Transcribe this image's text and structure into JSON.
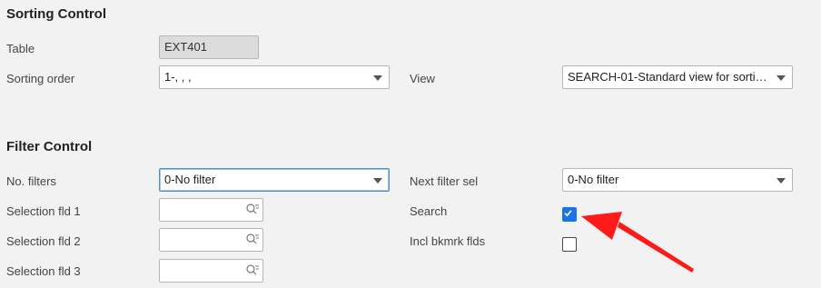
{
  "sorting": {
    "title": "Sorting Control",
    "table_label": "Table",
    "table_value": "EXT401",
    "order_label": "Sorting order",
    "order_value": "1-, , ,",
    "view_label": "View",
    "view_value": "SEARCH-01-Standard view for sorting..."
  },
  "filter": {
    "title": "Filter Control",
    "nofilters_label": "No. filters",
    "nofilters_value": "0-No filter",
    "nextfilter_label": "Next filter sel",
    "nextfilter_value": "0-No filter",
    "sel1_label": "Selection fld 1",
    "sel2_label": "Selection fld 2",
    "sel3_label": "Selection fld 3",
    "search_label": "Search",
    "search_checked": true,
    "bkmrk_label": "Incl bkmrk flds",
    "bkmrk_checked": false
  },
  "colors": {
    "accent": "#1a73e8",
    "arrow": "#ff0000"
  },
  "icons": [
    "chevron-down-icon",
    "search-list-icon",
    "checkmark-icon",
    "red-arrow-icon"
  ]
}
